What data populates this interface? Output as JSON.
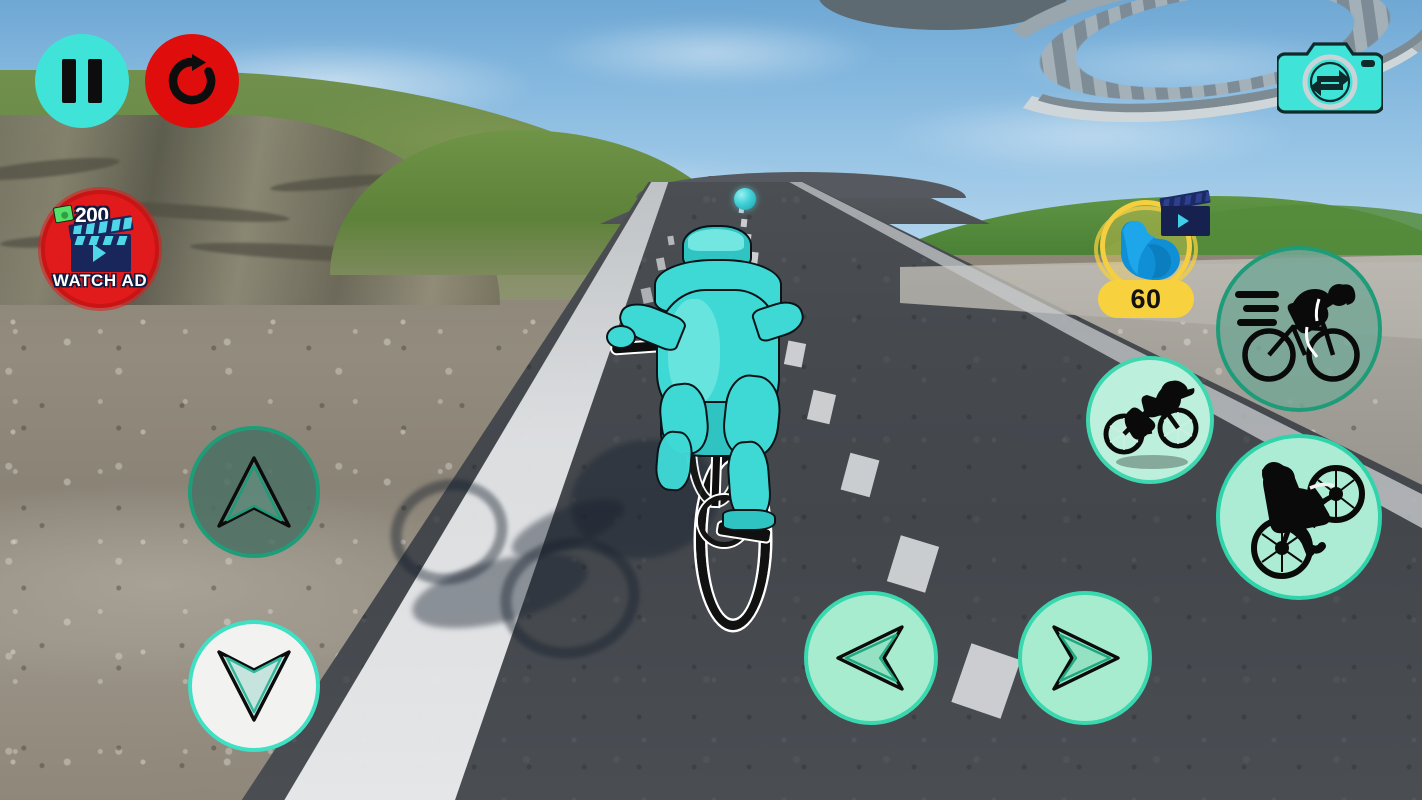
{
  "game": {
    "title": "Bicycle Extreme Rider 3D",
    "hud_theme_accent": "#3ad8ae",
    "hud_theme_danger": "#e11b1b",
    "hud_theme_gold": "#f7d23e"
  },
  "top_left_controls": {
    "pause": {
      "label": "Pause",
      "icon": "pause-icon"
    },
    "restart": {
      "label": "Restart",
      "icon": "restart-icon",
      "color": "#e00d0d"
    }
  },
  "watch_ad": {
    "reward_amount": "200",
    "label": "WATCH AD",
    "money_icon": "money-icon",
    "video_icon": "clapperboard-play-icon",
    "color": "#e11b1b"
  },
  "camera": {
    "label": "Switch Camera",
    "icon": "camera-switch-icon",
    "color": "#3fe3d8"
  },
  "stamina": {
    "value": "60",
    "icon": "flexed-bicep-icon",
    "boost_ad_icon": "clapperboard-play-icon",
    "color": "#f7d23e"
  },
  "action_buttons": [
    {
      "name": "sprint",
      "label": "Sprint",
      "icon": "speed-cyclist-icon",
      "fill": "#76a796"
    },
    {
      "name": "jump",
      "label": "Jump",
      "icon": "jumping-bmx-icon",
      "fill": "#bdf0dc"
    },
    {
      "name": "wheelie",
      "label": "Wheelie",
      "icon": "wheelie-bike-icon",
      "fill": "#acecd4"
    }
  ],
  "movement_controls": [
    {
      "name": "accelerate",
      "label": "Accelerate",
      "icon": "arrow-up-icon",
      "state": "idle",
      "fill": "#4d7064"
    },
    {
      "name": "brake",
      "label": "Brake / Reverse",
      "icon": "arrow-down-icon",
      "state": "pressed",
      "fill": "#f2f2f0"
    },
    {
      "name": "steer-left",
      "label": "Steer Left",
      "icon": "chevron-left-icon",
      "state": "idle",
      "fill": "#a8eccf"
    },
    {
      "name": "steer-right",
      "label": "Steer Right",
      "icon": "chevron-right-icon",
      "state": "idle",
      "fill": "#a8eccf"
    }
  ],
  "scene": {
    "description": "Third-person view of a cyan cyclist riding down a two-lane asphalt road through green hills under a blue sky",
    "player_color": "#3fd9d5",
    "road_color": "#464a4f",
    "sky_color": "#94c2e4",
    "grass_color": "#5d8239",
    "collectible": {
      "icon": "collectible-sphere",
      "color": "#3fd0d6"
    },
    "sky_structure": "elevated-loop-ramp"
  }
}
